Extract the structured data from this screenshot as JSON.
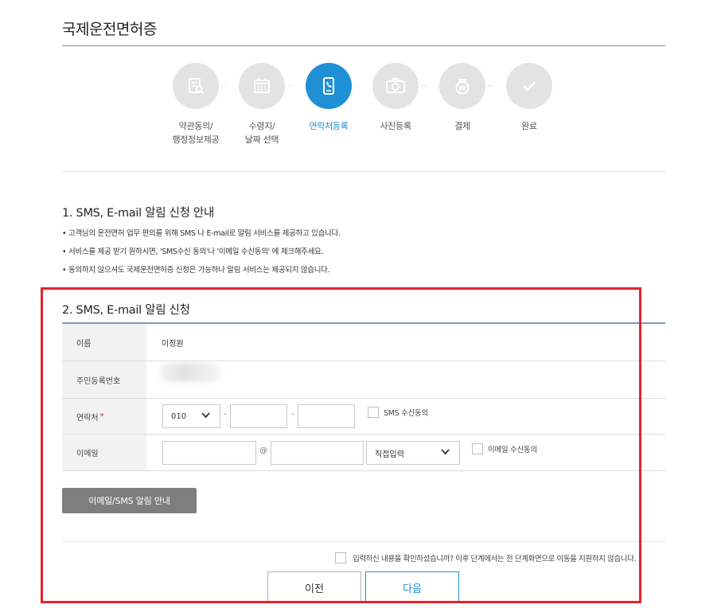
{
  "page": {
    "title": "국제운전면허증"
  },
  "steps": [
    {
      "label": "약관동의/\n행정정보제공",
      "icon": "document-search-icon",
      "active": false
    },
    {
      "label": "수령지/\n날짜 선택",
      "icon": "calendar-icon",
      "active": false
    },
    {
      "label": "연락처등록",
      "icon": "phone-icon",
      "active": true
    },
    {
      "label": "사진등록",
      "icon": "camera-icon",
      "active": false
    },
    {
      "label": "결제",
      "icon": "won-coin-icon",
      "active": false
    },
    {
      "label": "완료",
      "icon": "check-icon",
      "active": false
    }
  ],
  "section1": {
    "title": "1. SMS, E-mail 알림 신청 안내",
    "notices": [
      "• 고객님의 운전면허 업무 편의를 위해 SMS 나 E-mail로 알림 서비스를 제공하고 있습니다.",
      "• 서비스를 제공 받기 원하시면, 'SMS수신 동의'나 '이메일 수신동의' 에 체크해주세요.",
      "• 동의하지 않으셔도 국제운전면허증 신청은 가능하나 알림 서비스는 제공되지 않습니다."
    ]
  },
  "section2": {
    "title": "2. SMS, E-mail 알림 신청",
    "name_label": "이름",
    "name_value": "이정원",
    "rrn_label": "주민등록번호",
    "phone_label": "연락처",
    "phone_required": "*",
    "phone_prefix": "010",
    "phone_middle": "",
    "phone_last": "",
    "phone_sep": "-",
    "sms_consent": "SMS 수신동의",
    "email_label": "이메일",
    "email_id": "",
    "email_at": "@",
    "email_domain": "",
    "email_domain_select": "직접입력",
    "email_consent": "이메일 수신동의",
    "info_button": "이메일/SMS 알림 안내"
  },
  "footer": {
    "confirm_text": "입력하신 내용을 확인하셨습니까? 이후 단계에서는 전 단계화면으로 이동을 지원하지 않습니다.",
    "prev_button": "이전",
    "next_button": "다음"
  },
  "colors": {
    "accent": "#1f8fd6",
    "highlight": "#e3232b",
    "step_inactive": "#e3e3e3"
  }
}
